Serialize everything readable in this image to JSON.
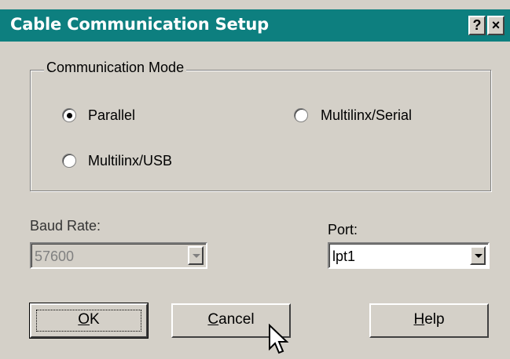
{
  "window": {
    "title": "Cable Communication Setup",
    "help_glyph": "?",
    "close_glyph": "×"
  },
  "mode_group": {
    "label": "Communication Mode",
    "options": [
      {
        "label": "Parallel",
        "selected": true
      },
      {
        "label": "Multilinx/Serial",
        "selected": false
      },
      {
        "label": "Multilinx/USB",
        "selected": false
      }
    ]
  },
  "baud": {
    "label": "Baud Rate:",
    "value": "57600",
    "enabled": false
  },
  "port": {
    "label": "Port:",
    "value": "lpt1",
    "enabled": true
  },
  "buttons": {
    "ok": {
      "accel": "O",
      "rest": "K"
    },
    "cancel": {
      "accel": "C",
      "rest": "ancel"
    },
    "help": {
      "accel": "H",
      "rest": "elp"
    }
  },
  "colors": {
    "titlebar": "#0d7f7f",
    "face": "#d4d0c8"
  },
  "icons": {
    "cursor": "arrow-cursor-icon"
  }
}
